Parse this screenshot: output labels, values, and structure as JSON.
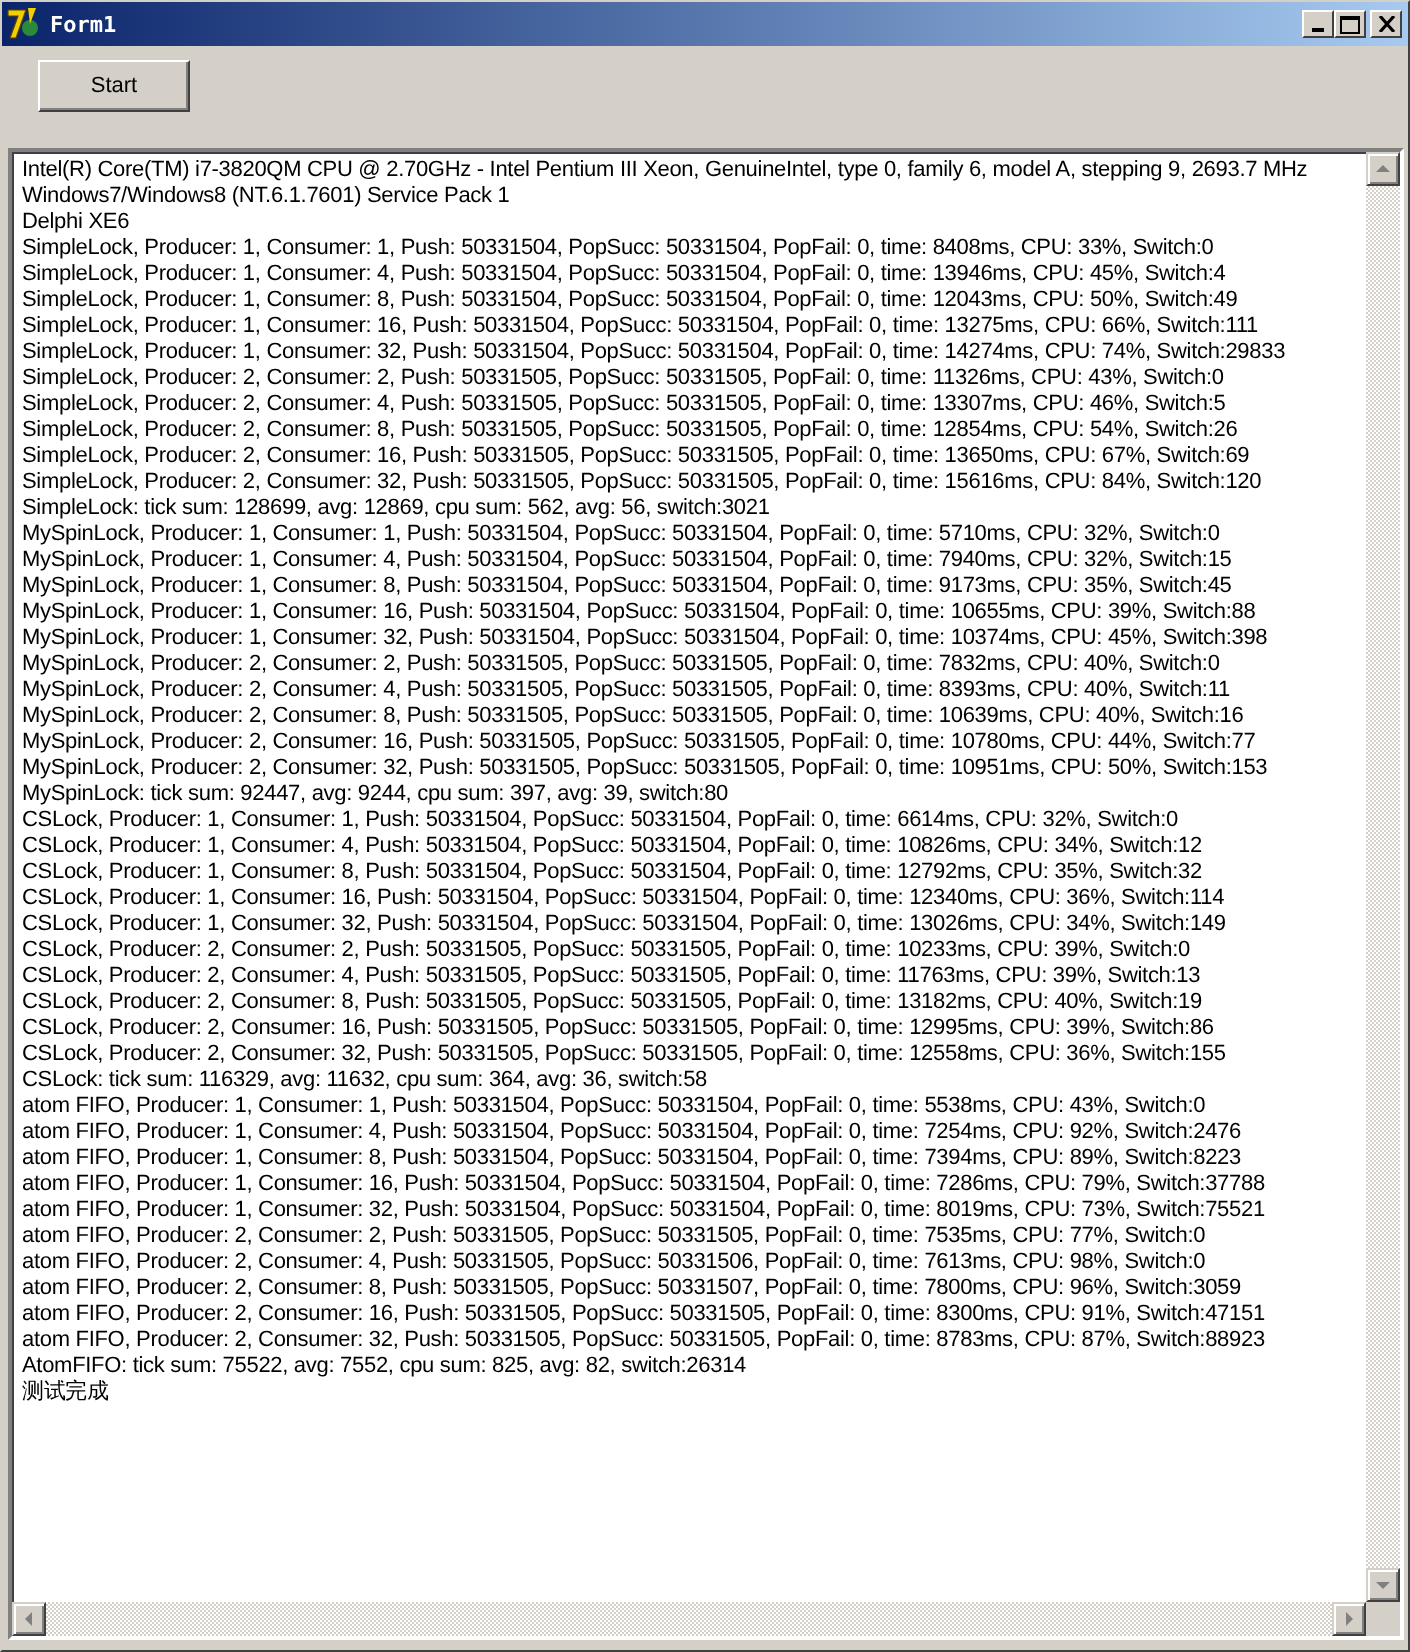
{
  "window": {
    "title": "Form1"
  },
  "buttons": [
    {
      "label": "Start"
    }
  ],
  "memo": {
    "lines": [
      "Intel(R) Core(TM) i7-3820QM CPU @ 2.70GHz - Intel Pentium III Xeon, GenuineIntel, type 0, family 6, model A, stepping 9, 2693.7 MHz",
      "Windows7/Windows8 (NT.6.1.7601) Service Pack 1",
      "Delphi XE6",
      "SimpleLock, Producer: 1, Consumer: 1, Push: 50331504, PopSucc: 50331504, PopFail: 0, time: 8408ms, CPU: 33%, Switch:0",
      "SimpleLock, Producer: 1, Consumer: 4, Push: 50331504, PopSucc: 50331504, PopFail: 0, time: 13946ms, CPU: 45%, Switch:4",
      "SimpleLock, Producer: 1, Consumer: 8, Push: 50331504, PopSucc: 50331504, PopFail: 0, time: 12043ms, CPU: 50%, Switch:49",
      "SimpleLock, Producer: 1, Consumer: 16, Push: 50331504, PopSucc: 50331504, PopFail: 0, time: 13275ms, CPU: 66%, Switch:111",
      "SimpleLock, Producer: 1, Consumer: 32, Push: 50331504, PopSucc: 50331504, PopFail: 0, time: 14274ms, CPU: 74%, Switch:29833",
      "SimpleLock, Producer: 2, Consumer: 2, Push: 50331505, PopSucc: 50331505, PopFail: 0, time: 11326ms, CPU: 43%, Switch:0",
      "SimpleLock, Producer: 2, Consumer: 4, Push: 50331505, PopSucc: 50331505, PopFail: 0, time: 13307ms, CPU: 46%, Switch:5",
      "SimpleLock, Producer: 2, Consumer: 8, Push: 50331505, PopSucc: 50331505, PopFail: 0, time: 12854ms, CPU: 54%, Switch:26",
      "SimpleLock, Producer: 2, Consumer: 16, Push: 50331505, PopSucc: 50331505, PopFail: 0, time: 13650ms, CPU: 67%, Switch:69",
      "SimpleLock, Producer: 2, Consumer: 32, Push: 50331505, PopSucc: 50331505, PopFail: 0, time: 15616ms, CPU: 84%, Switch:120",
      "SimpleLock: tick sum: 128699, avg: 12869, cpu sum: 562, avg: 56, switch:3021",
      "MySpinLock, Producer: 1, Consumer: 1, Push: 50331504, PopSucc: 50331504, PopFail: 0, time: 5710ms, CPU: 32%, Switch:0",
      "MySpinLock, Producer: 1, Consumer: 4, Push: 50331504, PopSucc: 50331504, PopFail: 0, time: 7940ms, CPU: 32%, Switch:15",
      "MySpinLock, Producer: 1, Consumer: 8, Push: 50331504, PopSucc: 50331504, PopFail: 0, time: 9173ms, CPU: 35%, Switch:45",
      "MySpinLock, Producer: 1, Consumer: 16, Push: 50331504, PopSucc: 50331504, PopFail: 0, time: 10655ms, CPU: 39%, Switch:88",
      "MySpinLock, Producer: 1, Consumer: 32, Push: 50331504, PopSucc: 50331504, PopFail: 0, time: 10374ms, CPU: 45%, Switch:398",
      "MySpinLock, Producer: 2, Consumer: 2, Push: 50331505, PopSucc: 50331505, PopFail: 0, time: 7832ms, CPU: 40%, Switch:0",
      "MySpinLock, Producer: 2, Consumer: 4, Push: 50331505, PopSucc: 50331505, PopFail: 0, time: 8393ms, CPU: 40%, Switch:11",
      "MySpinLock, Producer: 2, Consumer: 8, Push: 50331505, PopSucc: 50331505, PopFail: 0, time: 10639ms, CPU: 40%, Switch:16",
      "MySpinLock, Producer: 2, Consumer: 16, Push: 50331505, PopSucc: 50331505, PopFail: 0, time: 10780ms, CPU: 44%, Switch:77",
      "MySpinLock, Producer: 2, Consumer: 32, Push: 50331505, PopSucc: 50331505, PopFail: 0, time: 10951ms, CPU: 50%, Switch:153",
      "MySpinLock: tick sum: 92447, avg: 9244, cpu sum: 397, avg: 39, switch:80",
      "CSLock, Producer: 1, Consumer: 1, Push: 50331504, PopSucc: 50331504, PopFail: 0, time: 6614ms, CPU: 32%, Switch:0",
      "CSLock, Producer: 1, Consumer: 4, Push: 50331504, PopSucc: 50331504, PopFail: 0, time: 10826ms, CPU: 34%, Switch:12",
      "CSLock, Producer: 1, Consumer: 8, Push: 50331504, PopSucc: 50331504, PopFail: 0, time: 12792ms, CPU: 35%, Switch:32",
      "CSLock, Producer: 1, Consumer: 16, Push: 50331504, PopSucc: 50331504, PopFail: 0, time: 12340ms, CPU: 36%, Switch:114",
      "CSLock, Producer: 1, Consumer: 32, Push: 50331504, PopSucc: 50331504, PopFail: 0, time: 13026ms, CPU: 34%, Switch:149",
      "CSLock, Producer: 2, Consumer: 2, Push: 50331505, PopSucc: 50331505, PopFail: 0, time: 10233ms, CPU: 39%, Switch:0",
      "CSLock, Producer: 2, Consumer: 4, Push: 50331505, PopSucc: 50331505, PopFail: 0, time: 11763ms, CPU: 39%, Switch:13",
      "CSLock, Producer: 2, Consumer: 8, Push: 50331505, PopSucc: 50331505, PopFail: 0, time: 13182ms, CPU: 40%, Switch:19",
      "CSLock, Producer: 2, Consumer: 16, Push: 50331505, PopSucc: 50331505, PopFail: 0, time: 12995ms, CPU: 39%, Switch:86",
      "CSLock, Producer: 2, Consumer: 32, Push: 50331505, PopSucc: 50331505, PopFail: 0, time: 12558ms, CPU: 36%, Switch:155",
      "CSLock: tick sum: 116329, avg: 11632, cpu sum: 364, avg: 36, switch:58",
      "atom FIFO, Producer: 1, Consumer: 1, Push: 50331504, PopSucc: 50331504, PopFail: 0, time: 5538ms, CPU: 43%, Switch:0",
      "atom FIFO, Producer: 1, Consumer: 4, Push: 50331504, PopSucc: 50331504, PopFail: 0, time: 7254ms, CPU: 92%, Switch:2476",
      "atom FIFO, Producer: 1, Consumer: 8, Push: 50331504, PopSucc: 50331504, PopFail: 0, time: 7394ms, CPU: 89%, Switch:8223",
      "atom FIFO, Producer: 1, Consumer: 16, Push: 50331504, PopSucc: 50331504, PopFail: 0, time: 7286ms, CPU: 79%, Switch:37788",
      "atom FIFO, Producer: 1, Consumer: 32, Push: 50331504, PopSucc: 50331504, PopFail: 0, time: 8019ms, CPU: 73%, Switch:75521",
      "atom FIFO, Producer: 2, Consumer: 2, Push: 50331505, PopSucc: 50331505, PopFail: 0, time: 7535ms, CPU: 77%, Switch:0",
      "atom FIFO, Producer: 2, Consumer: 4, Push: 50331505, PopSucc: 50331506, PopFail: 0, time: 7613ms, CPU: 98%, Switch:0",
      "atom FIFO, Producer: 2, Consumer: 8, Push: 50331505, PopSucc: 50331507, PopFail: 0, time: 7800ms, CPU: 96%, Switch:3059",
      "atom FIFO, Producer: 2, Consumer: 16, Push: 50331505, PopSucc: 50331505, PopFail: 0, time: 8300ms, CPU: 91%, Switch:47151",
      "atom FIFO, Producer: 2, Consumer: 32, Push: 50331505, PopSucc: 50331505, PopFail: 0, time: 8783ms, CPU: 87%, Switch:88923",
      "AtomFIFO: tick sum: 75522, avg: 7552, cpu sum: 825, avg: 82, switch:26314",
      "测试完成"
    ]
  }
}
